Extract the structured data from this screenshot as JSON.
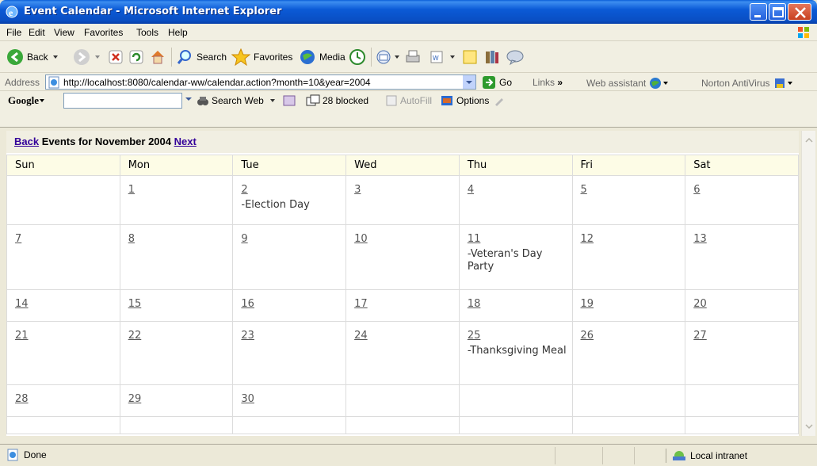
{
  "window": {
    "title": "Event Calendar - Microsoft Internet Explorer"
  },
  "menu": [
    "File",
    "Edit",
    "View",
    "Favorites",
    "Tools",
    "Help"
  ],
  "toolbar": {
    "back": "Back",
    "search": "Search",
    "favorites": "Favorites",
    "media": "Media"
  },
  "address": {
    "label": "Address",
    "url": "http://localhost:8080/calendar-ww/calendar.action?month=10&year=2004",
    "go": "Go",
    "links": "Links",
    "links_more": "»",
    "web_assistant": "Web assistant",
    "norton": "Norton AntiVirus"
  },
  "google": {
    "logo": "Google",
    "search_web": "Search Web",
    "blocked": "28 blocked",
    "autofill": "AutoFill",
    "options": "Options"
  },
  "calendar": {
    "back": "Back",
    "title": "Events for November 2004",
    "next": "Next",
    "weekdays": [
      "Sun",
      "Mon",
      "Tue",
      "Wed",
      "Thu",
      "Fri",
      "Sat"
    ],
    "weeks": [
      [
        {
          "day": ""
        },
        {
          "day": "1"
        },
        {
          "day": "2",
          "event": "-Election Day"
        },
        {
          "day": "3"
        },
        {
          "day": "4"
        },
        {
          "day": "5"
        },
        {
          "day": "6"
        }
      ],
      [
        {
          "day": "7"
        },
        {
          "day": "8"
        },
        {
          "day": "9"
        },
        {
          "day": "10"
        },
        {
          "day": "11",
          "event": "-Veteran's Day Party"
        },
        {
          "day": "12"
        },
        {
          "day": "13"
        }
      ],
      [
        {
          "day": "14"
        },
        {
          "day": "15"
        },
        {
          "day": "16"
        },
        {
          "day": "17"
        },
        {
          "day": "18"
        },
        {
          "day": "19"
        },
        {
          "day": "20"
        }
      ],
      [
        {
          "day": "21"
        },
        {
          "day": "22"
        },
        {
          "day": "23"
        },
        {
          "day": "24"
        },
        {
          "day": "25",
          "event": "-Thanksgiving Meal"
        },
        {
          "day": "26"
        },
        {
          "day": "27"
        }
      ],
      [
        {
          "day": "28"
        },
        {
          "day": "29"
        },
        {
          "day": "30"
        },
        {
          "day": ""
        },
        {
          "day": ""
        },
        {
          "day": ""
        },
        {
          "day": ""
        }
      ],
      [
        {
          "day": ""
        },
        {
          "day": ""
        },
        {
          "day": ""
        },
        {
          "day": ""
        },
        {
          "day": ""
        },
        {
          "day": ""
        },
        {
          "day": ""
        }
      ]
    ]
  },
  "status": {
    "text": "Done",
    "zone": "Local intranet"
  }
}
